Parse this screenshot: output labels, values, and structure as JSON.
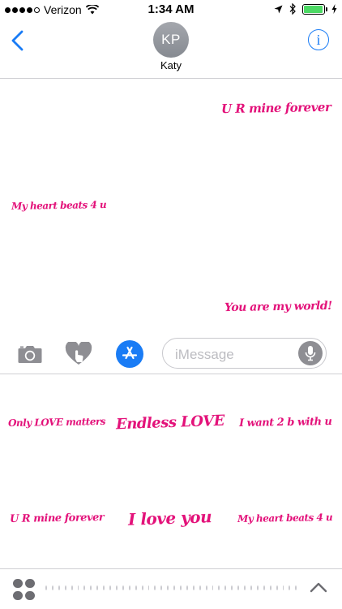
{
  "status_bar": {
    "carrier": "Verizon",
    "time": "1:34 AM",
    "signal_bars": 4,
    "signal_total": 5,
    "battery_level": 0.95
  },
  "header": {
    "contact_initials": "KP",
    "contact_name": "Katy",
    "info_label": "i"
  },
  "conversation": {
    "messages": [
      {
        "text": "U R mine forever",
        "side": "right"
      },
      {
        "text": "My heart beats  4 u",
        "side": "left"
      },
      {
        "text": "You are my world!",
        "side": "right"
      }
    ]
  },
  "composer": {
    "placeholder": "iMessage",
    "icons": [
      "camera-icon",
      "digital-touch-heart-icon",
      "app-store-icon",
      "microphone-icon"
    ]
  },
  "drawer": {
    "stickers": [
      {
        "text": "Only LOVE matters"
      },
      {
        "text": "Endless LOVE"
      },
      {
        "text": "I want 2 b with u"
      },
      {
        "text": "U R mine forever"
      },
      {
        "text": "I love you"
      },
      {
        "text": "My heart beats  4 u"
      }
    ]
  },
  "app_strip": {
    "icons": [
      "app-drawer-grid-icon",
      "chevron-up-icon"
    ],
    "page_dots": 40
  },
  "colors": {
    "accent": "#1a7cf5",
    "sticker": "#e3127a",
    "battery": "#4cd964"
  }
}
